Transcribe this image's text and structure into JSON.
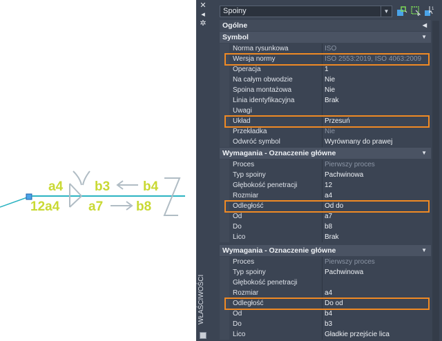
{
  "drawing": {
    "weld_labels": {
      "top_left": "a4",
      "top_right": "b3",
      "top_far": "b4",
      "bottom_left": "12a4",
      "bottom_mid": "a7",
      "bottom_far": "b8"
    }
  },
  "strip": {
    "title": "WŁAŚCIWOŚCI"
  },
  "toolbar": {
    "selector_value": "Spoiny"
  },
  "general": {
    "label": "Ogólne"
  },
  "sections": [
    {
      "title": "Symbol",
      "rows": [
        {
          "label": "Norma rysunkowa",
          "value": "ISO"
        },
        {
          "label": "Wersja normy",
          "value": "ISO 2553:2019, ISO 4063:2009"
        },
        {
          "label": "Operacja",
          "value": "1"
        },
        {
          "label": "Na całym obwodzie",
          "value": "Nie"
        },
        {
          "label": "Spoina montażowa",
          "value": "Nie"
        },
        {
          "label": "Linia identyfikacyjna",
          "value": "Brak"
        },
        {
          "label": "Uwagi",
          "value": ""
        },
        {
          "label": "Układ",
          "value": "Przesuń"
        },
        {
          "label": "Przekładka",
          "value": "Nie"
        },
        {
          "label": "Odwróć symbol",
          "value": "Wyrównany do prawej"
        }
      ]
    },
    {
      "title": "Wymagania - Oznaczenie główne",
      "rows": [
        {
          "label": "Proces",
          "value": "Pierwszy proces"
        },
        {
          "label": "Typ spoiny",
          "value": "Pachwinowa"
        },
        {
          "label": "Głębokość penetracji",
          "value": "12"
        },
        {
          "label": "Rozmiar",
          "value": "a4"
        },
        {
          "label": "Odległość",
          "value": "Od do"
        },
        {
          "label": "Od",
          "value": "a7"
        },
        {
          "label": "Do",
          "value": "b8"
        },
        {
          "label": "Lico",
          "value": "Brak"
        }
      ]
    },
    {
      "title": "Wymagania - Oznaczenie główne",
      "rows": [
        {
          "label": "Proces",
          "value": "Pierwszy proces"
        },
        {
          "label": "Typ spoiny",
          "value": "Pachwinowa"
        },
        {
          "label": "Głębokość penetracji",
          "value": ""
        },
        {
          "label": "Rozmiar",
          "value": "a4"
        },
        {
          "label": "Odległość",
          "value": "Do od"
        },
        {
          "label": "Od",
          "value": "b4"
        },
        {
          "label": "Do",
          "value": "b3"
        },
        {
          "label": "Lico",
          "value": "Gładkie przejście lica"
        }
      ]
    }
  ]
}
